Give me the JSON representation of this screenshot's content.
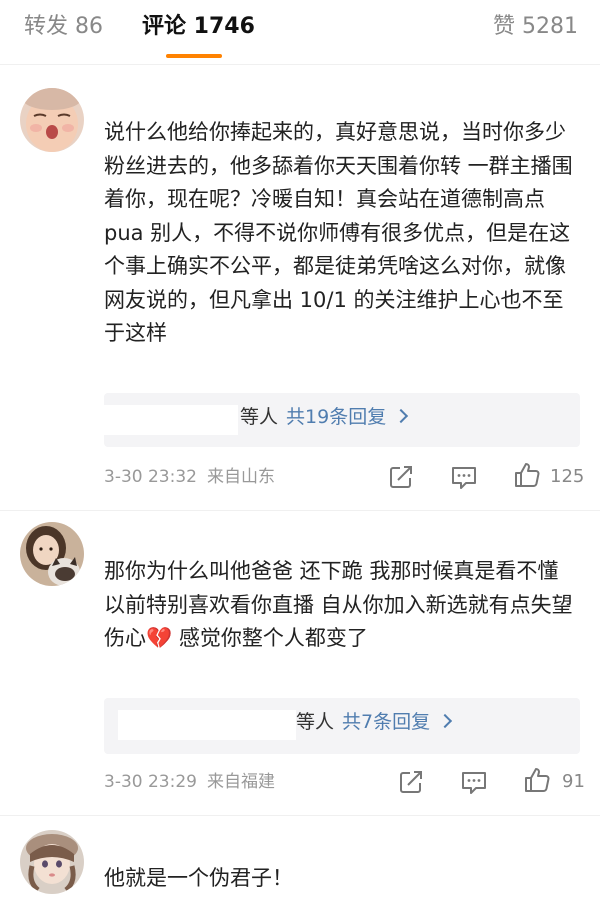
{
  "tabs": {
    "repost": "转发 86",
    "comment": "评论 1746",
    "like": "赞 5281"
  },
  "comments": [
    {
      "text": "说什么他给你捧起来的，真好意思说，当时你多少粉丝进去的，他多舔着你天天围着你转 一群主播围着你，现在呢？冷暖自知！真会站在道德制高点 pua 别人，不得不说你师傅有很多优点，但是在这个事上确实不公平，都是徒弟凭啥这么对你，就像网友说的，但凡拿出 10/1 的关注维护上心也不至于这样",
      "reply_people": "等人",
      "reply_count": "共19条回复",
      "time": "3-30 23:32",
      "location": "来自山东",
      "likes": "125"
    },
    {
      "text": "那你为什么叫他爸爸 还下跪 我那时候真是看不懂 以前特别喜欢看你直播 自从你加入新选就有点失望伤心💔 感觉你整个人都变了",
      "reply_people": "等人",
      "reply_count": "共7条回复",
      "time": "3-30 23:29",
      "location": "来自福建",
      "likes": "91"
    },
    {
      "text": "他就是一个伪君子！"
    }
  ],
  "icons": {
    "share": "share-icon",
    "comment": "comment-icon",
    "like": "thumb-up-icon",
    "reply_arrow": "chevron-right-icon"
  },
  "colors": {
    "accent": "#ff8200",
    "link": "#507daf",
    "meta": "#999999"
  }
}
